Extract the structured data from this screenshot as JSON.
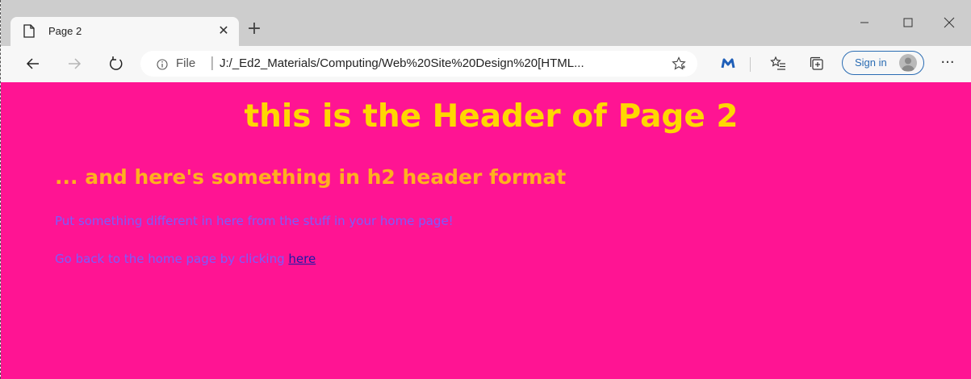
{
  "browser": {
    "tab": {
      "title": "Page 2",
      "close_glyph": "✕",
      "icon": "document-icon"
    },
    "new_tab_glyph": "+",
    "window_controls": {
      "minimize": "—",
      "maximize": "☐",
      "close": "✕"
    },
    "address": {
      "scheme": "File",
      "separator": "|",
      "url": "J:/_Ed2_Materials/Computing/Web%20Site%20Design%20[HTML..."
    },
    "sign_in_label": "Sign in",
    "more_glyph": "···"
  },
  "page": {
    "h1": "this is the Header of Page 2",
    "h2": "... and here's something in h2 header format",
    "paragraph1": "Put something different in here from the stuff in your home page!",
    "paragraph2_text": "Go back to the home page by clicking ",
    "paragraph2_link": "here"
  },
  "colors": {
    "page_background": "#ff1493",
    "h1_color": "#ffd700",
    "h2_color": "#ffb01f",
    "paragraph_color": "#7a5cff",
    "link_color": "#1a1aa6"
  }
}
